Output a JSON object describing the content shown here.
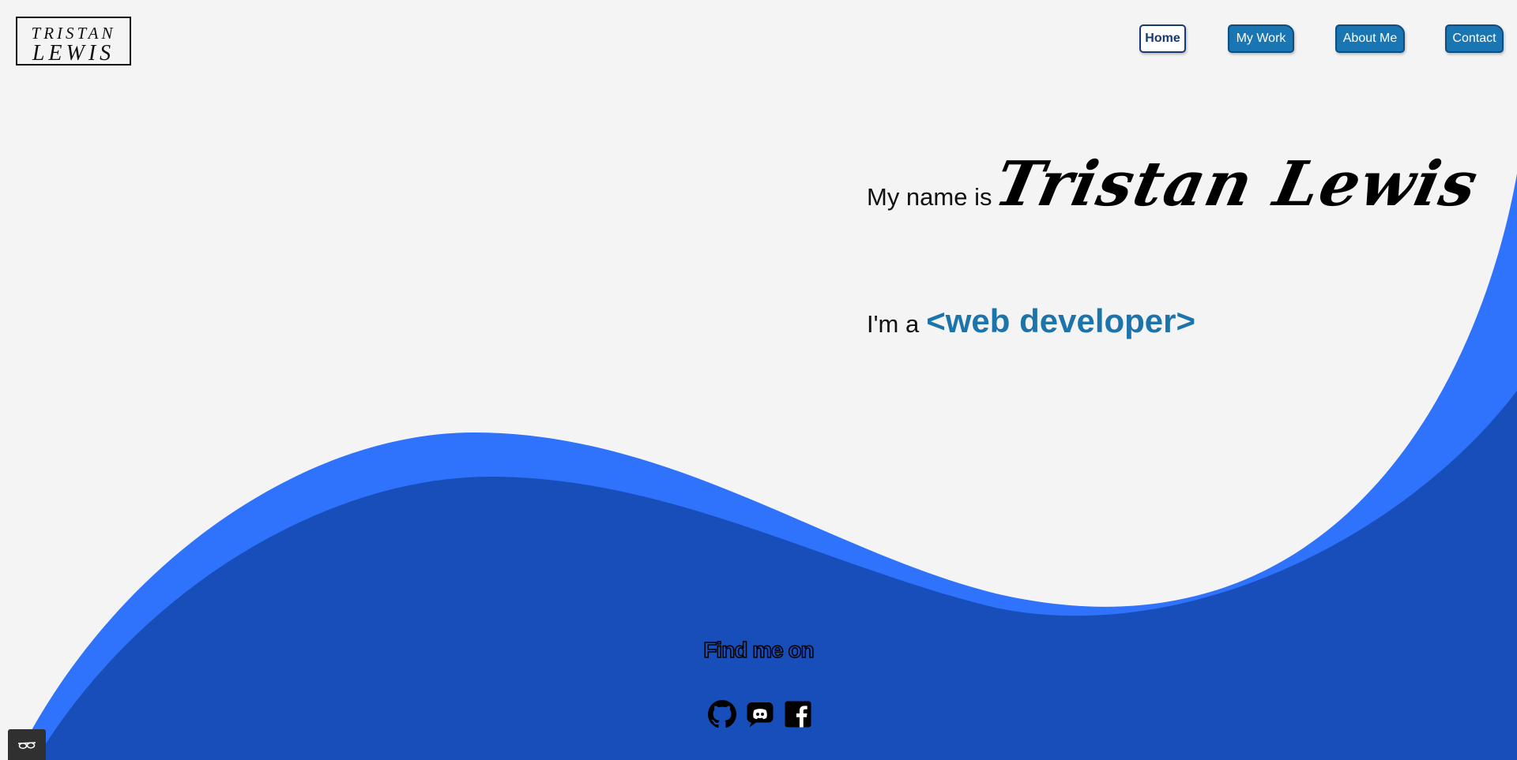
{
  "logo": {
    "line1": "TRISTAN",
    "line2": "LEWIS"
  },
  "nav": {
    "home": "Home",
    "work": "My Work",
    "about": "About Me",
    "contact": "Contact"
  },
  "intro": {
    "name_prefix": "My name is",
    "name": "Tristan Lewis",
    "role_prefix": "I'm a",
    "role": "<web developer>"
  },
  "social": {
    "heading": "Find me on",
    "icons": [
      "github-icon",
      "discord-icon",
      "facebook-icon"
    ]
  },
  "colors": {
    "background": "#f4f4f4",
    "wave_light": "#2f72fb",
    "wave_dark": "#174eba",
    "accent": "#1d74ab",
    "nav_button": "#1a75b3"
  }
}
